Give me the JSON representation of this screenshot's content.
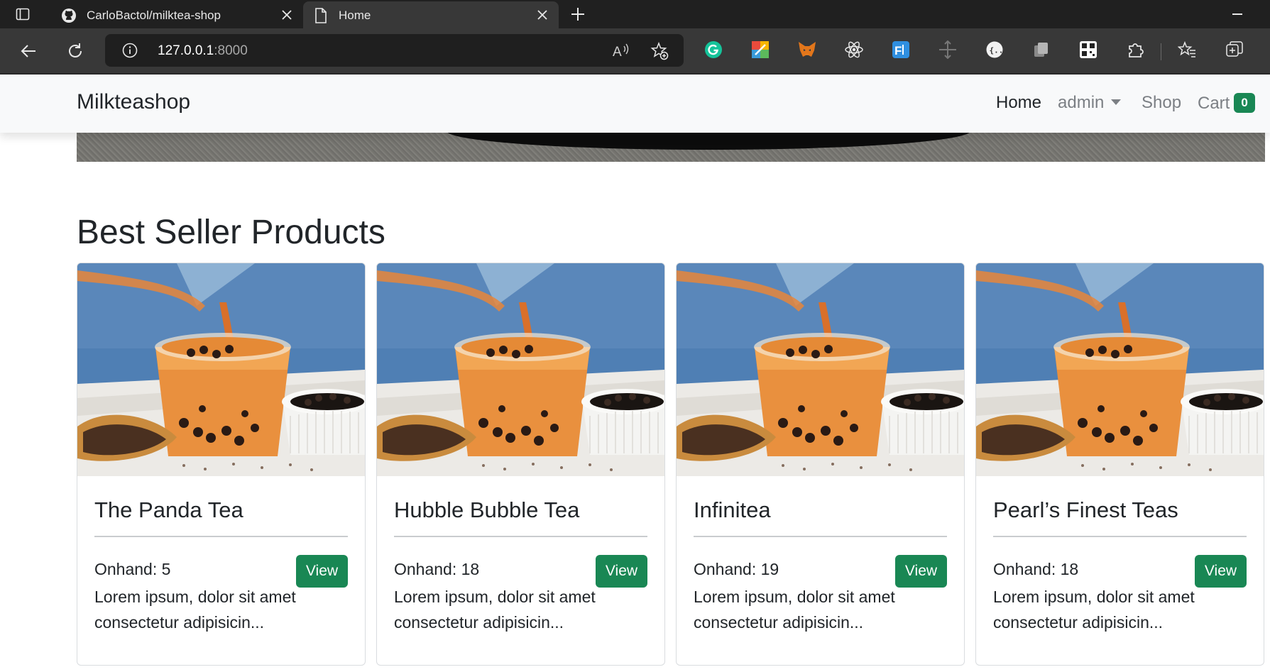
{
  "browser": {
    "tabs": [
      {
        "title": "CarloBactol/milktea-shop",
        "favicon": "github-icon",
        "active": false
      },
      {
        "title": "Home",
        "favicon": "page-icon",
        "active": true
      }
    ],
    "url_host": "127.0.0.1",
    "url_port": ":8000",
    "extensions": [
      "grammarly-icon",
      "color-picker-icon",
      "metamask-icon",
      "react-devtools-icon",
      "font-identifier-icon",
      "move-icon",
      "json-viewer-icon",
      "copy-icon",
      "qr-code-icon",
      "extensions-icon",
      "favorites-icon",
      "collections-icon"
    ]
  },
  "navbar": {
    "brand": "Milkteashop",
    "links": {
      "home": "Home",
      "admin": "admin",
      "shop": "Shop",
      "cart": "Cart"
    },
    "cart_count": "0"
  },
  "section": {
    "title": "Best Seller Products"
  },
  "products": [
    {
      "name": "The Panda Tea",
      "onhand": "Onhand: 5",
      "description": "Lorem ipsum, dolor sit amet consectetur adipisicin...",
      "button": "View"
    },
    {
      "name": "Hubble Bubble Tea",
      "onhand": "Onhand: 18",
      "description": "Lorem ipsum, dolor sit amet consectetur adipisicin...",
      "button": "View"
    },
    {
      "name": "Infinitea",
      "onhand": "Onhand: 19",
      "description": "Lorem ipsum, dolor sit amet consectetur adipisicin...",
      "button": "View"
    },
    {
      "name": "Pearl’s Finest Teas",
      "onhand": "Onhand: 18",
      "description": "Lorem ipsum, dolor sit amet consectetur adipisicin...",
      "button": "View"
    }
  ],
  "colors": {
    "accent_green": "#198754",
    "chrome_dark": "#202020",
    "chrome_toolbar": "#383838",
    "navbar_bg": "#f8f9fa"
  }
}
